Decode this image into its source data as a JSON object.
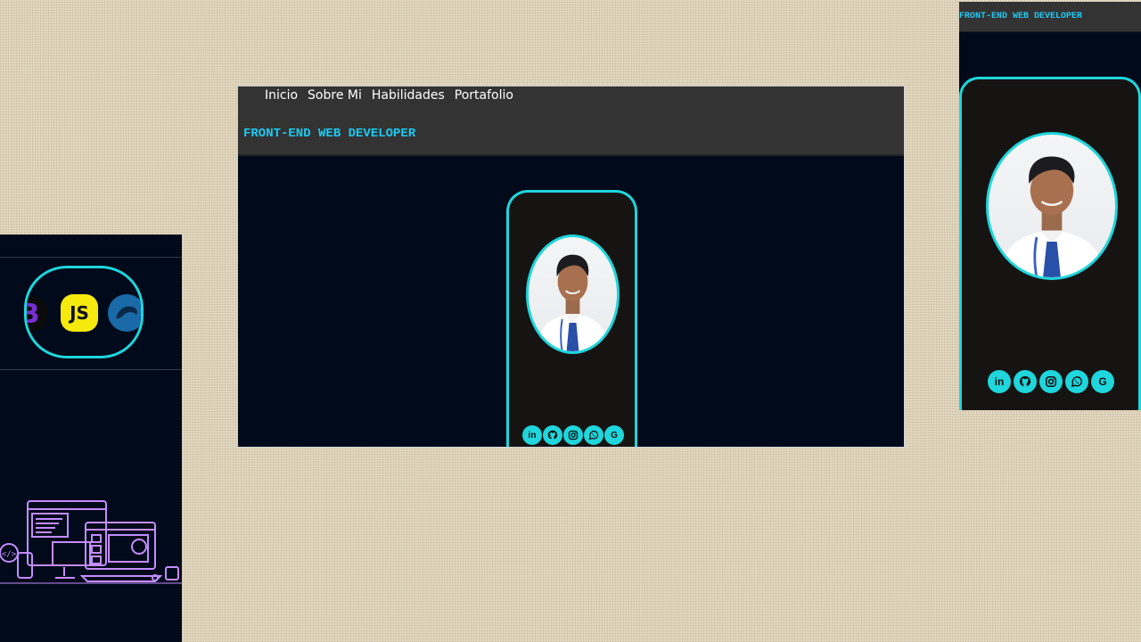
{
  "nav": {
    "items": [
      {
        "label": "Inicio"
      },
      {
        "label": "Sobre Mi"
      },
      {
        "label": "Habilidades"
      },
      {
        "label": "Portafolio"
      }
    ]
  },
  "brand": {
    "title": "FRONT-END WEB DEVELOPER"
  },
  "skills": {
    "icons": [
      "bootstrap-icon",
      "javascript-icon",
      "mysql-icon"
    ],
    "js_label": "JS",
    "bootstrap_letter": "B"
  },
  "socials": {
    "icons": [
      "linkedin-icon",
      "github-icon",
      "instagram-icon",
      "whatsapp-icon",
      "google-icon"
    ],
    "linkedin_glyph": "in",
    "google_glyph": "G"
  },
  "colors": {
    "accent": "#1ed6dc",
    "brand_text": "#1ec8f0",
    "page_bg": "#000a1a",
    "topbar": "#333333",
    "card": "#161412",
    "illustration": "#c48cff"
  }
}
